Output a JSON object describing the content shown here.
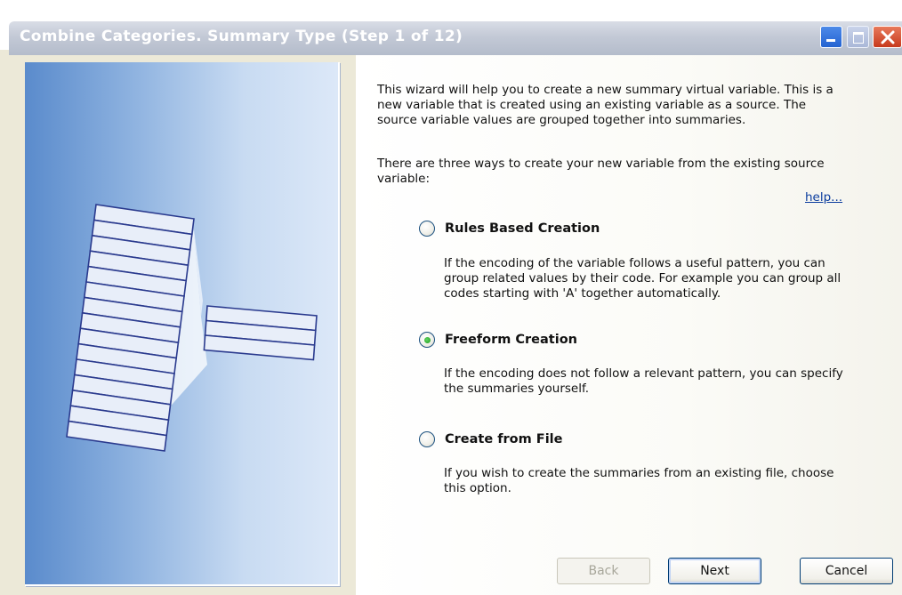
{
  "window": {
    "title": "Combine Categories.  Summary Type (Step 1 of 12)"
  },
  "content": {
    "intro": "This wizard will help you to create a new summary virtual variable. This is a new variable that is created using an existing variable as a source. The source variable values are grouped together into summaries.",
    "ways": "There are three ways to create your new variable from the existing source variable:",
    "help_link": "help...",
    "options": [
      {
        "label": "Rules Based Creation",
        "description": "If the encoding of the variable follows a useful pattern, you can group related values by their code. For example you can group all codes starting with 'A' together automatically.",
        "selected": false
      },
      {
        "label": "Freeform Creation",
        "description": "If the encoding does not follow a relevant pattern, you can specify the summaries yourself.",
        "selected": true
      },
      {
        "label": "Create from File",
        "description": "If you wish to create the summaries from an existing file, choose this option.",
        "selected": false
      }
    ]
  },
  "buttons": {
    "back": "Back",
    "next": "Next",
    "cancel": "Cancel"
  },
  "colors": {
    "title_bar": "#c3c9d6",
    "panel_gradient_start": "#5a8bcc",
    "panel_gradient_end": "#dce8f8",
    "link": "#0a3c9e",
    "radio_selected": "#1d9c1d"
  },
  "icons": {
    "minimize": "minimize-icon",
    "maximize": "maximize-icon",
    "close": "close-icon",
    "illustration": "summary-illustration"
  }
}
